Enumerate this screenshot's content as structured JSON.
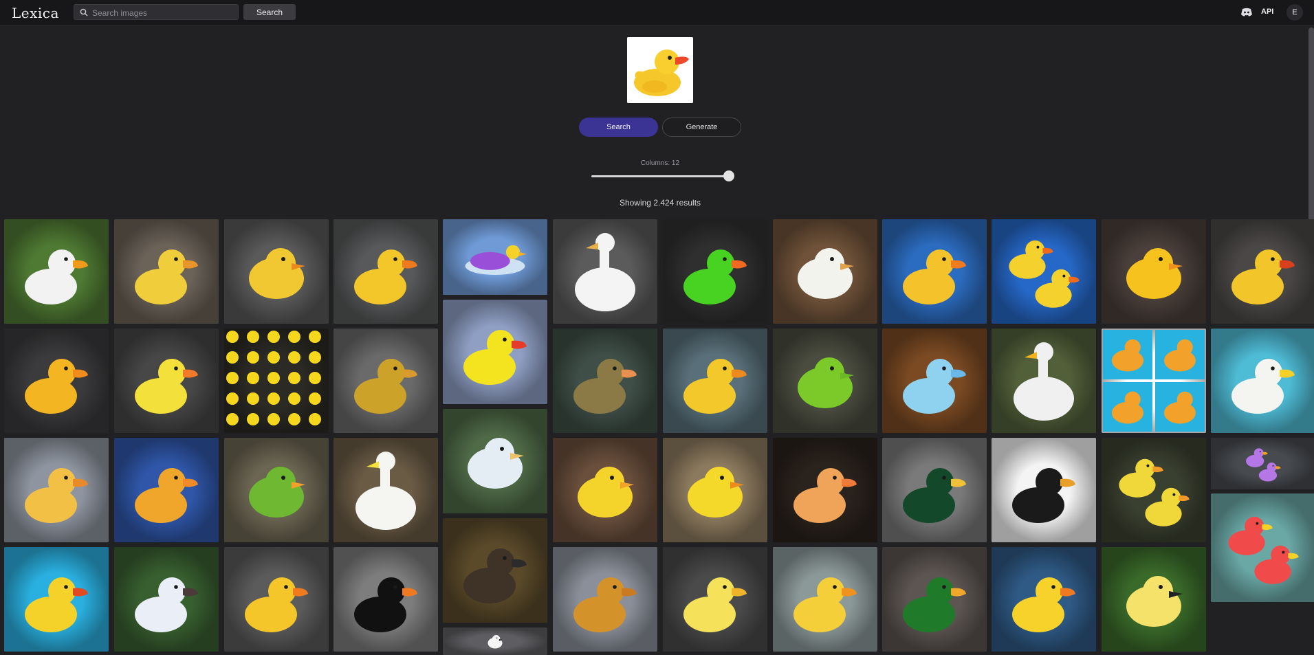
{
  "brand": "Lexica",
  "search": {
    "placeholder": "Search images",
    "button_label": "Search"
  },
  "nav": {
    "api_label": "API",
    "avatar_initial": "E"
  },
  "query": {
    "search_button": "Search",
    "generate_button": "Generate"
  },
  "columns": {
    "label": "Columns: 12",
    "value": 12,
    "max": 12
  },
  "results": {
    "text": "Showing 2.424 results"
  },
  "colors": {
    "accent": "#3b3494",
    "background": "#212124",
    "topbar": "#17171a"
  },
  "tiles": [
    {
      "bg": "#4f7a33",
      "body": "#f2f2f2",
      "beak": "#f29a1c",
      "kind": "duck"
    },
    {
      "bg": "#6b6258",
      "body": "#f0cd3a",
      "beak": "#e8962b",
      "kind": "duck"
    },
    {
      "bg": "#5a5a5a",
      "body": "#f2c832",
      "beak": "#e88a1e",
      "kind": "blob"
    },
    {
      "bg": "#58595a",
      "body": "#f3c629",
      "beak": "#ee7a20",
      "kind": "duck"
    },
    {
      "bg": "#6f9ad6",
      "body": "#9a4fd8",
      "beak": "#f6b21f",
      "kind": "float"
    },
    {
      "bg": "#5b5b5b",
      "body": "#f4f4f4",
      "beak": "#e8b04a",
      "kind": "swan"
    },
    {
      "bg": "#2f2f2f",
      "body": "#48d322",
      "beak": "#f06a22",
      "kind": "duck"
    },
    {
      "bg": "#6f5239",
      "body": "#f3f3ee",
      "beak": "#e0a24a",
      "kind": "blob"
    },
    {
      "bg": "#2c6cc0",
      "body": "#f4c22a",
      "beak": "#f27b22",
      "kind": "duck"
    },
    {
      "bg": "#2668c8",
      "body": "#f5d12e",
      "beak": "#f06a1e",
      "kind": "pair"
    },
    {
      "bg": "#4a3f3a",
      "body": "#f6c21d",
      "beak": "#f0901f",
      "kind": "blob"
    },
    {
      "bg": "#4b4747",
      "body": "#f2c62a",
      "beak": "#d8401e",
      "kind": "duck"
    },
    {
      "bg": "#3b3b3d",
      "body": "#f4b522",
      "beak": "#f08b1c",
      "kind": "duck"
    },
    {
      "bg": "#474747",
      "body": "#f4e03a",
      "beak": "#f07a2a",
      "kind": "duck"
    },
    {
      "bg": "#2b2a25",
      "body": "#f5d81e",
      "beak": "#e8a12e",
      "kind": "many"
    },
    {
      "bg": "#6a6a6a",
      "body": "#cda229",
      "beak": "#d99a2e",
      "kind": "duck"
    },
    {
      "bg": "#8f9fc4",
      "body": "#f4e420",
      "beak": "#e53c2a",
      "kind": "duck"
    },
    {
      "bg": "#3f4f47",
      "body": "#8c7a46",
      "beak": "#e89050",
      "kind": "duck"
    },
    {
      "bg": "#59707a",
      "body": "#f3c82a",
      "beak": "#ee8a1e",
      "kind": "duck"
    },
    {
      "bg": "#4a4c3f",
      "body": "#7cca2a",
      "beak": "#6bb826",
      "kind": "blob"
    },
    {
      "bg": "#7b4a23",
      "body": "#8ed2f0",
      "beak": "#6ab8ea",
      "kind": "duck"
    },
    {
      "bg": "#52603a",
      "body": "#f0f0f0",
      "beak": "#f0b41e",
      "kind": "swan"
    },
    {
      "bg": "#ffffff",
      "body": "#f2a22a",
      "beak": "#f0901f",
      "kind": "grid"
    },
    {
      "bg": "#4fbcd6",
      "body": "#f4f4f0",
      "beak": "#f5d02a",
      "kind": "duck"
    },
    {
      "bg": "#8e95a0",
      "body": "#f3c046",
      "beak": "#e8892a",
      "kind": "duck"
    },
    {
      "bg": "#2f56a8",
      "body": "#f0a62a",
      "beak": "#f28a2a",
      "kind": "duck"
    },
    {
      "bg": "#6b6552",
      "body": "#6fb832",
      "beak": "#f2a12a",
      "kind": "blob"
    },
    {
      "bg": "#6a5b45",
      "body": "#f5f5f2",
      "beak": "#f5e33a",
      "kind": "swan"
    },
    {
      "bg": "#4f6a47",
      "body": "#e4ecf4",
      "beak": "#eec26a",
      "kind": "blob"
    },
    {
      "bg": "#6a4f3c",
      "body": "#f4d42a",
      "beak": "#f0a22a",
      "kind": "blob"
    },
    {
      "bg": "#8c7a5e",
      "body": "#f4d82a",
      "beak": "#ee8a1e",
      "kind": "blob"
    },
    {
      "bg": "#2a221c",
      "body": "#f0a45a",
      "beak": "#f07a3a",
      "kind": "duck"
    },
    {
      "bg": "#7a7a7a",
      "body": "#13492a",
      "beak": "#f0c23a",
      "kind": "duck"
    },
    {
      "bg": "#f4f4f4",
      "body": "#1a1a1a",
      "beak": "#e8a02a",
      "kind": "duck"
    },
    {
      "bg": "#3a4030",
      "body": "#f0d83a",
      "beak": "#f09a2a",
      "kind": "pair"
    },
    {
      "bg": "#474a4f",
      "body": "#b576e6",
      "beak": "#f5a21f",
      "kind": "pair"
    },
    {
      "bg": "#2ab0e0",
      "body": "#f4d22a",
      "beak": "#e24a22",
      "kind": "duck"
    },
    {
      "bg": "#385f30",
      "body": "#eaeef6",
      "beak": "#4a3a3a",
      "kind": "duck"
    },
    {
      "bg": "#5b5b5b",
      "body": "#f5c62a",
      "beak": "#f07a1e",
      "kind": "duck"
    },
    {
      "bg": "#7d7d7d",
      "body": "#111111",
      "beak": "#f07a22",
      "kind": "duck"
    },
    {
      "bg": "#5a4a2a",
      "body": "#3f3226",
      "beak": "#2b2b2b",
      "kind": "goose"
    },
    {
      "bg": "#8a8f99",
      "body": "#d4922a",
      "beak": "#c97a22",
      "kind": "duck"
    },
    {
      "bg": "#4a4a4a",
      "body": "#f5e25a",
      "beak": "#f0b42a",
      "kind": "duck"
    },
    {
      "bg": "#8c9999",
      "body": "#f4cf3a",
      "beak": "#f0921e",
      "kind": "duck"
    },
    {
      "bg": "#5c5552",
      "body": "#1f7a2a",
      "beak": "#f0a82a",
      "kind": "duck"
    },
    {
      "bg": "#2f5a86",
      "body": "#f6d22a",
      "beak": "#f07a22",
      "kind": "duck"
    },
    {
      "bg": "#3a6a2a",
      "body": "#f4e26a",
      "beak": "#222222",
      "kind": "blob"
    },
    {
      "bg": "#6aa8a6",
      "body": "#f04a4a",
      "beak": "#f5d22a",
      "kind": "pair"
    },
    {
      "bg": "#5e5e62",
      "body": "#f6f6f6",
      "beak": "#222222",
      "kind": "blob"
    }
  ]
}
